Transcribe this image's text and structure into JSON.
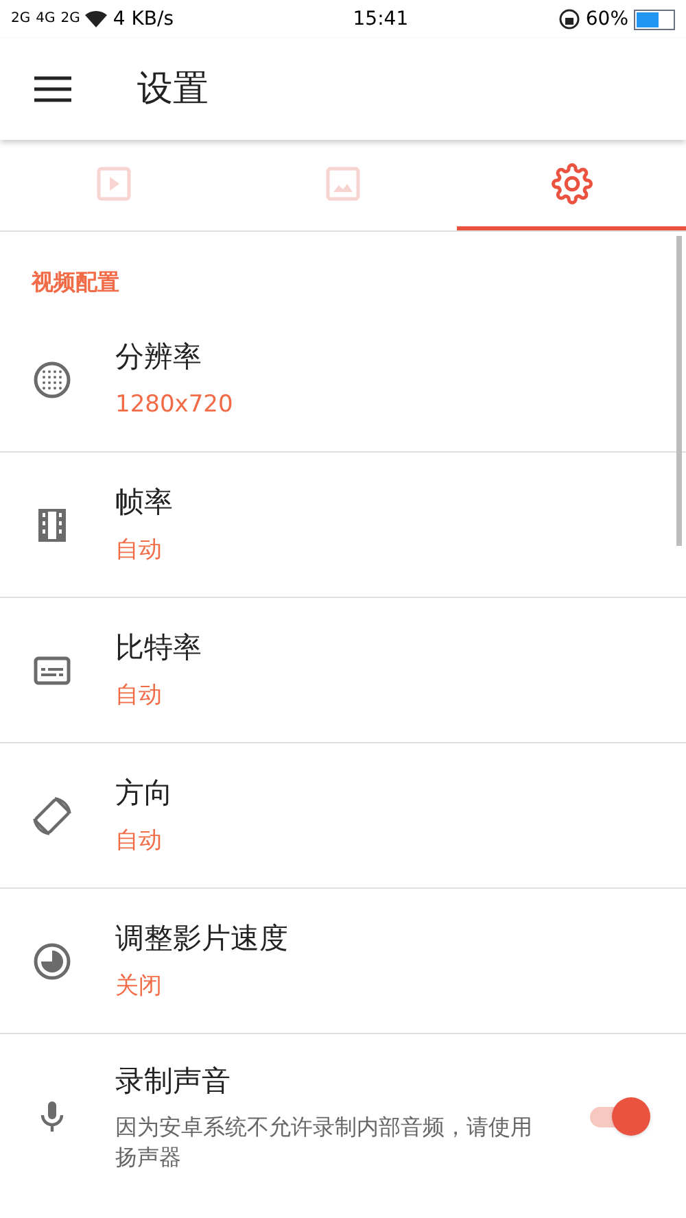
{
  "status_bar": {
    "signal_labels": [
      "2G",
      "4G",
      "2G"
    ],
    "speed": "4 KB/s",
    "time": "15:41",
    "battery": "60%"
  },
  "app_bar": {
    "title": "设置"
  },
  "tabs": [
    {
      "selected": false
    },
    {
      "selected": false
    },
    {
      "selected": true
    }
  ],
  "section": {
    "title": "视频配置"
  },
  "items": [
    {
      "kind": "value",
      "title": "分辨率",
      "value": "1280x720"
    },
    {
      "kind": "value",
      "title": "帧率",
      "value": "自动"
    },
    {
      "kind": "value",
      "title": "比特率",
      "value": "自动"
    },
    {
      "kind": "value",
      "title": "方向",
      "value": "自动"
    },
    {
      "kind": "value",
      "title": "调整影片速度",
      "value": "关闭"
    },
    {
      "kind": "toggle",
      "title": "录制声音",
      "description": "因为安卓系统不允许录制内部音频，请使用扬声器",
      "on": true
    }
  ]
}
